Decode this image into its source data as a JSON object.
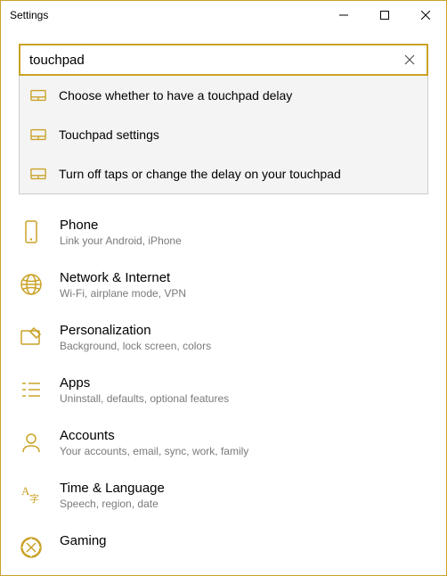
{
  "window": {
    "title": "Settings"
  },
  "search": {
    "value": "touchpad"
  },
  "suggestions": [
    {
      "label": "Choose whether to have a touchpad delay"
    },
    {
      "label": "Touchpad settings"
    },
    {
      "label": "Turn off taps or change the delay on your touchpad"
    }
  ],
  "categories": [
    {
      "title": "Phone",
      "sub": "Link your Android, iPhone"
    },
    {
      "title": "Network & Internet",
      "sub": "Wi-Fi, airplane mode, VPN"
    },
    {
      "title": "Personalization",
      "sub": "Background, lock screen, colors"
    },
    {
      "title": "Apps",
      "sub": "Uninstall, defaults, optional features"
    },
    {
      "title": "Accounts",
      "sub": "Your accounts, email, sync, work, family"
    },
    {
      "title": "Time & Language",
      "sub": "Speech, region, date"
    },
    {
      "title": "Gaming",
      "sub": ""
    }
  ]
}
